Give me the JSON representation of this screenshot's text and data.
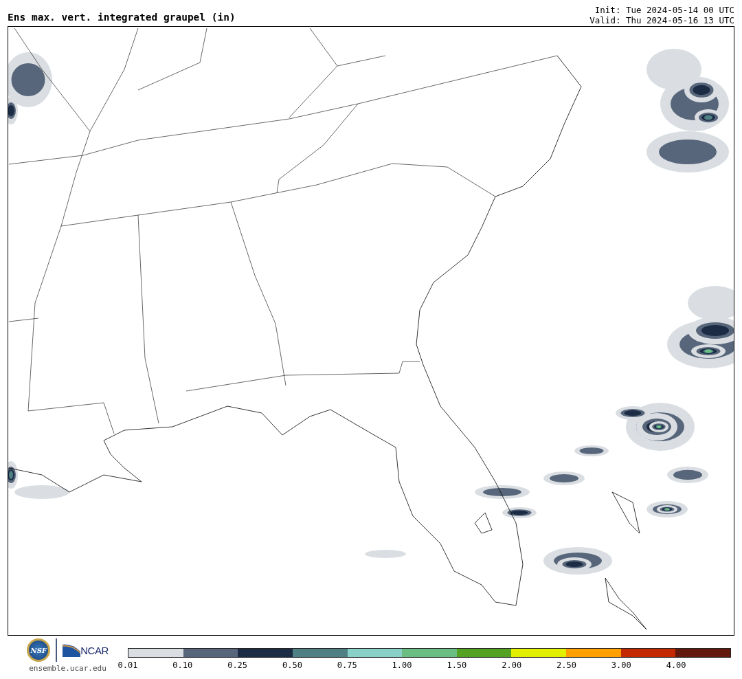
{
  "title": "Ens max. vert. integrated graupel (in)",
  "init": "Init: Tue 2024-05-14 00 UTC",
  "valid": "Valid: Thu 2024-05-16 13 UTC",
  "logos": {
    "nsf": "NSF",
    "ncar": "NCAR"
  },
  "site": "ensemble.ucar.edu",
  "legend": [
    {
      "label": "0.01",
      "color": "#dadee2"
    },
    {
      "label": "0.10",
      "color": "#57667a"
    },
    {
      "label": "0.25",
      "color": "#1c2c44"
    },
    {
      "label": "0.50",
      "color": "#4f8084"
    },
    {
      "label": "0.75",
      "color": "#88d0c8"
    },
    {
      "label": "1.00",
      "color": "#6bbe82"
    },
    {
      "label": "1.50",
      "color": "#54a224"
    },
    {
      "label": "2.00",
      "color": "#e2f000"
    },
    {
      "label": "2.50",
      "color": "#ffa000"
    },
    {
      "label": "3.00",
      "color": "#c42800"
    },
    {
      "label": "4.00",
      "color": "#62190c"
    }
  ]
}
